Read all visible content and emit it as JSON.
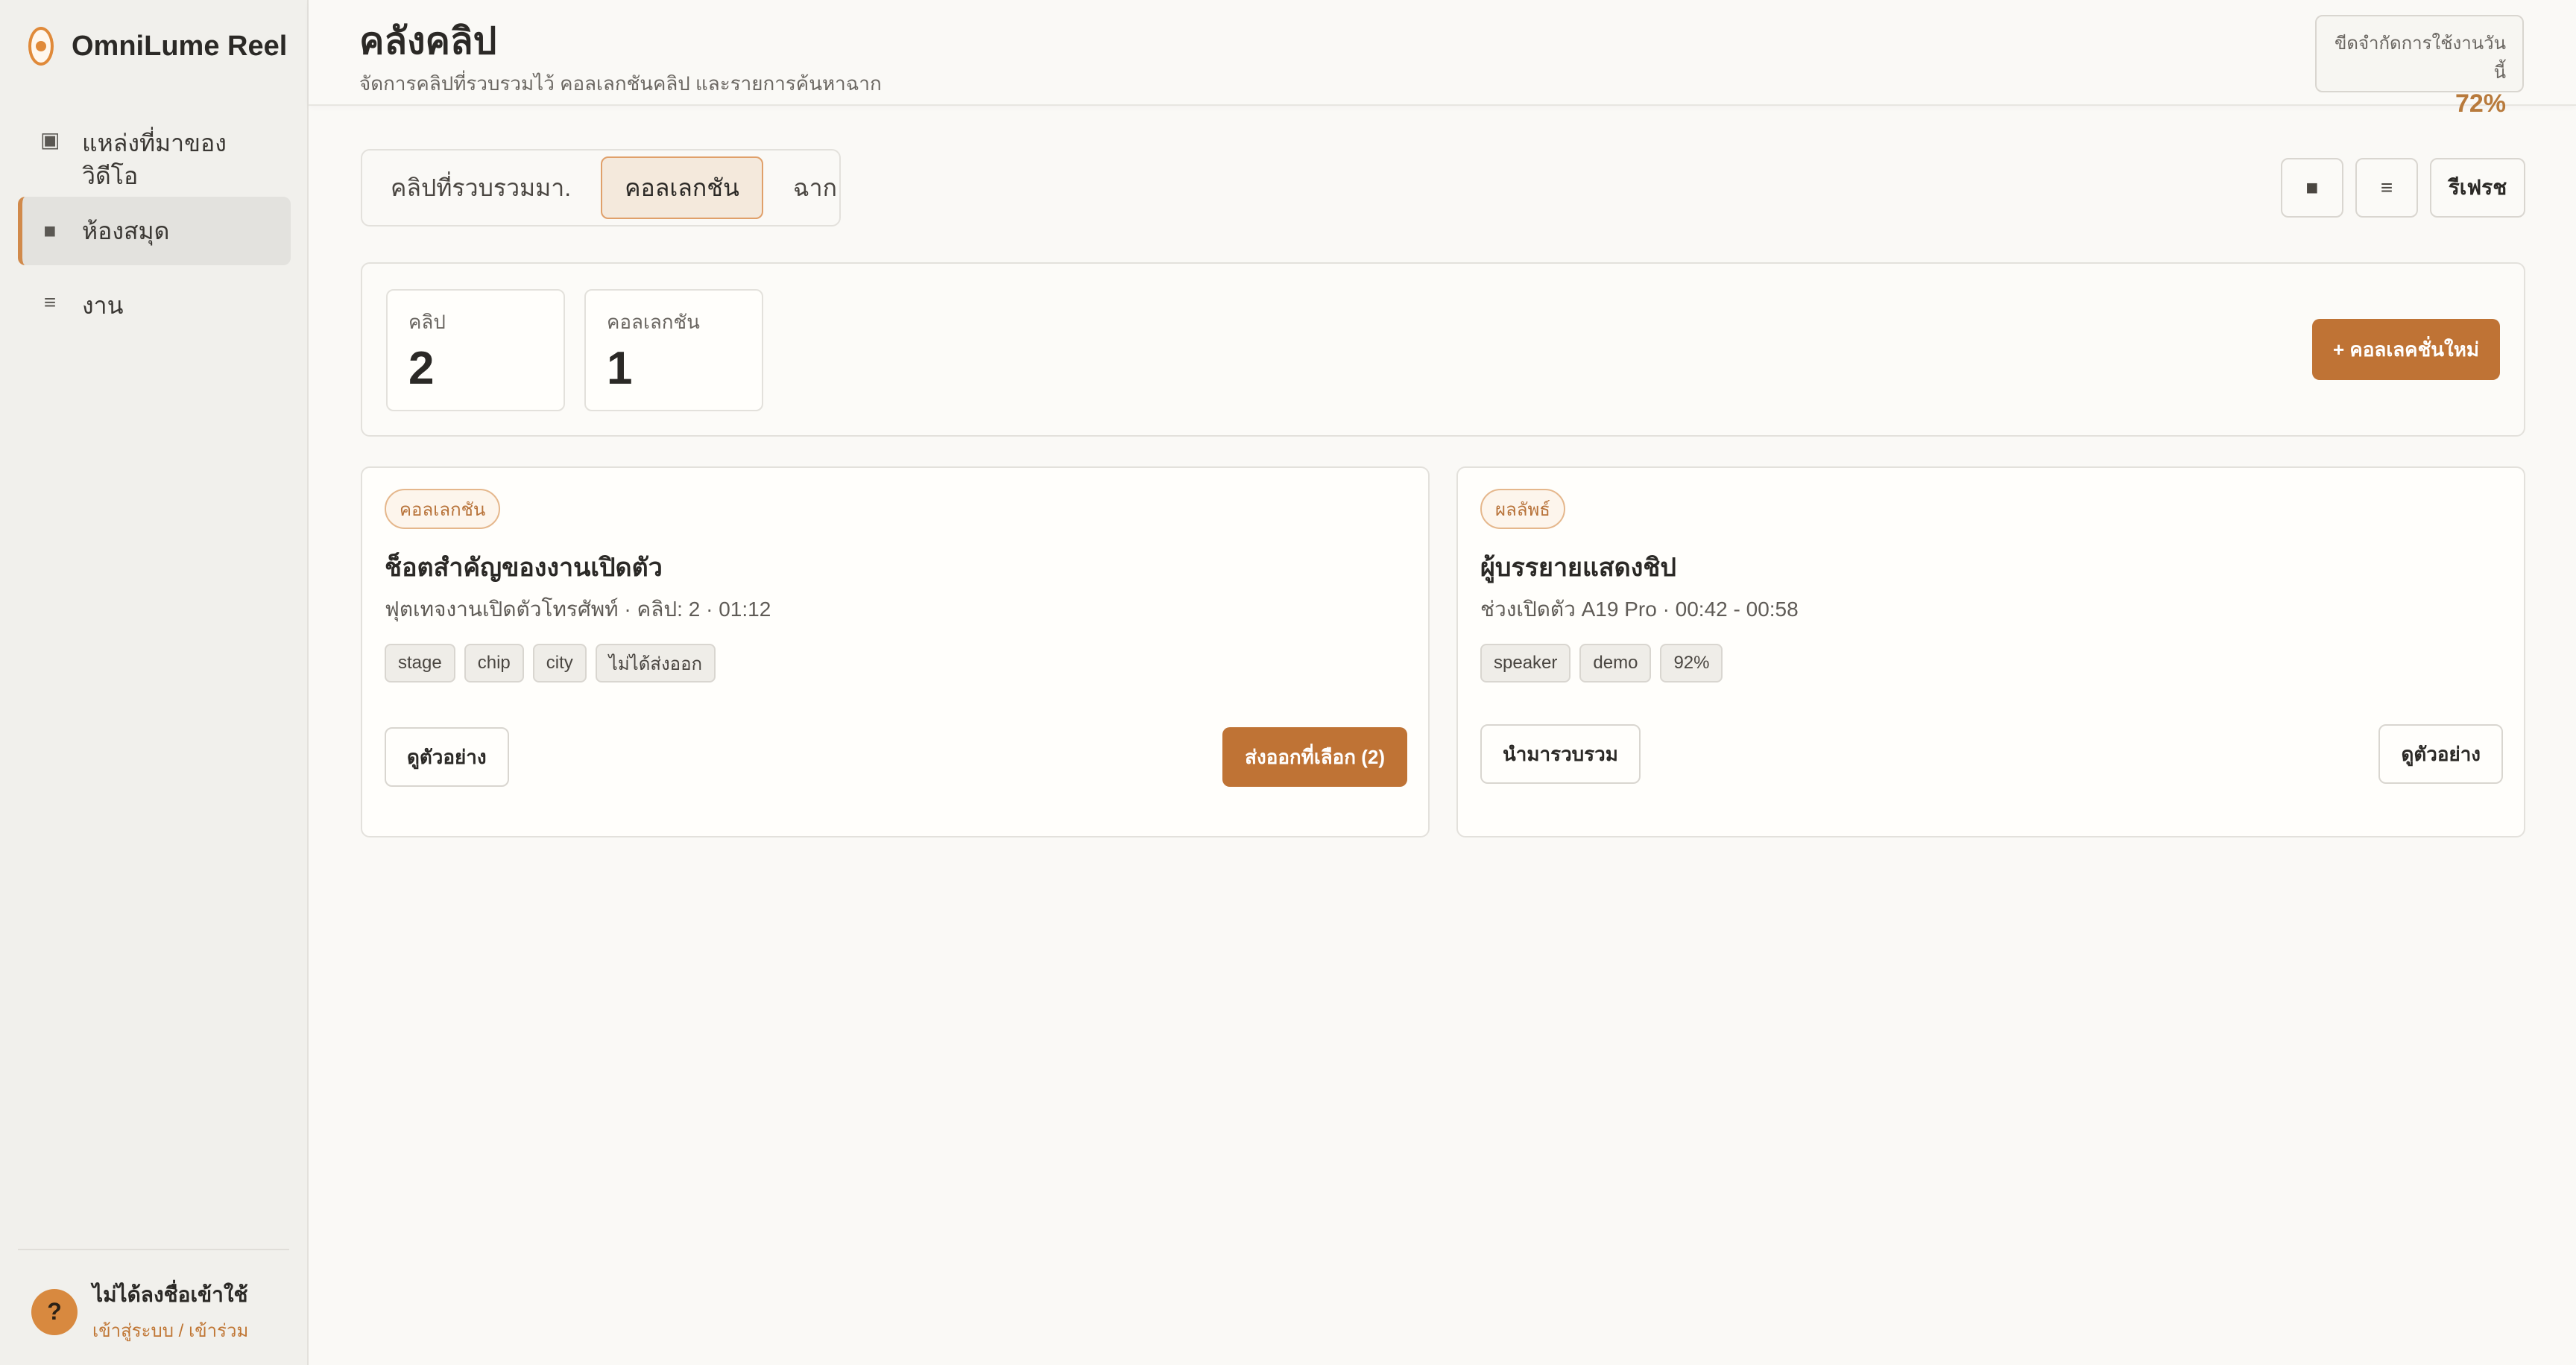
{
  "app": {
    "name": "OmniLume Reel"
  },
  "sidebar": {
    "items": [
      {
        "icon": "video-source-icon",
        "label": "แหล่งที่มาของ",
        "label2": "วิดีโอ"
      },
      {
        "icon": "library-icon",
        "label": "ห้องสมุด",
        "active": true
      },
      {
        "icon": "tasks-icon",
        "label": "งาน"
      }
    ],
    "user": {
      "avatar": "?",
      "name": "ไม่ได้ลงชื่อเข้าใช้",
      "link": "เข้าสู่ระบบ / เข้าร่วม"
    }
  },
  "header": {
    "title": "คลังคลิป",
    "subtitle": "จัดการคลิปที่รวบรวมไว้ คอลเลกชันคลิป และรายการค้นหาฉาก",
    "quota_label": "ขีดจำกัดการใช้งานวันนี้",
    "quota_value": "72%"
  },
  "tabs": [
    {
      "label": "คลิปที่รวบรวมมา."
    },
    {
      "label": "คอลเลกชัน",
      "active": true
    },
    {
      "label": "ฉาก"
    }
  ],
  "toolbar": {
    "grid_icon": "■",
    "list_icon": "≡",
    "refresh_label": "รีเฟรช"
  },
  "stats": {
    "clips_label": "คลิป",
    "clips_value": "2",
    "collections_label": "คอลเลกชัน",
    "collections_value": "1",
    "new_collection_label": "+ คอลเลคชั่นใหม่"
  },
  "cards": [
    {
      "badge": "คอลเลกชัน",
      "title": "ช็อตสำคัญของงานเปิดตัว",
      "meta": "ฟุตเทจงานเปิดตัวโทรศัพท์ · คลิป: 2 · 01:12",
      "tags": [
        "stage",
        "chip",
        "city",
        "ไม่ได้ส่งออก"
      ],
      "preview_label": "ดูตัวอย่าง",
      "export_label": "ส่งออกที่เลือก (2)"
    },
    {
      "badge": "ผลลัพธ์",
      "title": "ผู้บรรยายแสดงชิป",
      "meta": "ช่วงเปิดตัว A19 Pro · 00:42 - 00:58",
      "tags": [
        "speaker",
        "demo",
        "92%"
      ],
      "import_label": "นำมารวบรวม",
      "preview_label": "ดูตัวอย่าง"
    }
  ],
  "colors": {
    "accent": "#bf7335",
    "sidebar_bg": "#f1f0ec",
    "page_bg": "#faf9f6"
  }
}
